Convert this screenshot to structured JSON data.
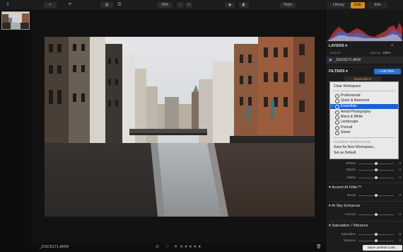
{
  "toolbar": {
    "open_label": "+",
    "sidebar_label": "",
    "zoom_value": "20%",
    "zoom_minus": "−",
    "zoom_plus": "+",
    "tools_label": "Tools",
    "mode_tabs": [
      {
        "label": "Library",
        "active": false
      },
      {
        "label": "Edit",
        "active": true
      },
      {
        "label": "Info",
        "active": false
      }
    ]
  },
  "bottombar": {
    "filename": "_DSC6171.ARW",
    "save_look_label": "Save Luminar Look..."
  },
  "panel": {
    "layers": {
      "title": "LAYERS",
      "blend_mode": "Normal",
      "opacity_label": "Opacity:",
      "opacity_value": "100%",
      "layer_name": "_DSC6171.ARW"
    },
    "filters": {
      "title": "FILTERS",
      "workspace_button": "Essentials",
      "add_filter_label": "+ Add Filter..."
    },
    "dropdown": {
      "clear_label": "Clear Workspace",
      "items": [
        {
          "label": "Professional",
          "selected": false
        },
        {
          "label": "Quick & Awesome",
          "selected": false
        },
        {
          "label": "Essentials",
          "selected": true
        },
        {
          "label": "Aerial Photography",
          "selected": false
        },
        {
          "label": "Black & White",
          "selected": false
        },
        {
          "label": "Landscape",
          "selected": false
        },
        {
          "label": "Portrait",
          "selected": false
        },
        {
          "label": "Street",
          "selected": false
        }
      ],
      "current_workspace_label": "CURRENT WORKSPACE",
      "save_as_new_label": "Save As New Workspace...",
      "set_default_label": "Set as Default"
    },
    "sliders_top": [
      {
        "label": "Whites",
        "value": "0"
      },
      {
        "label": "Blacks",
        "value": "0"
      },
      {
        "label": "Clarity",
        "value": "0"
      }
    ],
    "accent": {
      "title": "Accent AI Filter™",
      "slider": {
        "label": "Boost",
        "value": "0"
      }
    },
    "sky": {
      "title": "AI Sky Enhancer",
      "slider": {
        "label": "Amount",
        "value": "0"
      }
    },
    "saturation": {
      "title": "Saturation / Vibrance",
      "sliders": [
        {
          "label": "Saturation",
          "value": "0"
        },
        {
          "label": "Vibrance",
          "value": "0"
        }
      ]
    }
  },
  "colors": {
    "accent": "#d88a1a",
    "selection": "#1a5fd6",
    "add_filter": "#2a6fd6"
  }
}
